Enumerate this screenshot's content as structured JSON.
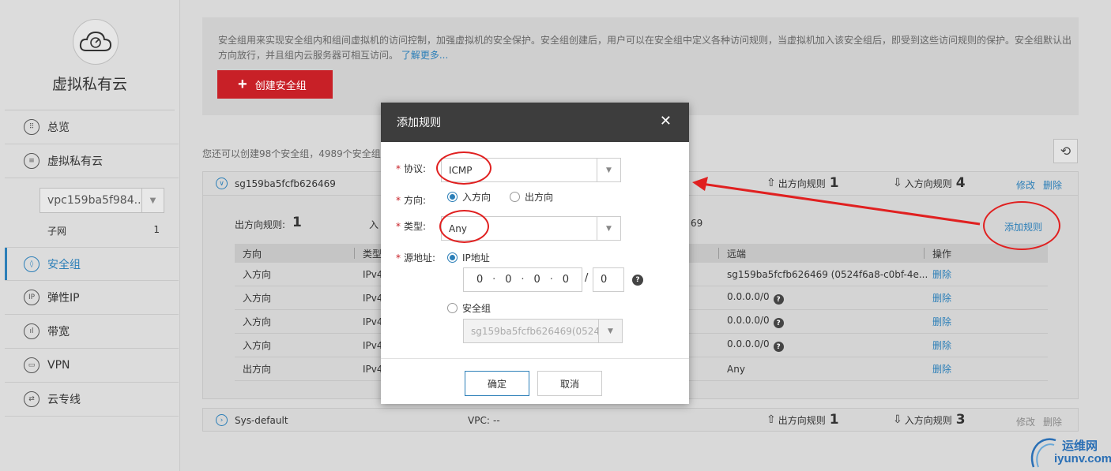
{
  "sidebar": {
    "brand_title": "虚拟私有云",
    "items": [
      {
        "label": "总览",
        "icon": "overview-icon"
      },
      {
        "label": "虚拟私有云",
        "icon": "vpc-icon"
      },
      {
        "label": "安全组",
        "icon": "shield-icon",
        "active": true
      },
      {
        "label": "弹性IP",
        "icon": "ip-icon"
      },
      {
        "label": "带宽",
        "icon": "bandwidth-icon"
      },
      {
        "label": "VPN",
        "icon": "vpn-icon"
      },
      {
        "label": "云专线",
        "icon": "direct-connect-icon"
      }
    ],
    "vpc_select": "vpc159ba5f984...",
    "subnet_label": "子网",
    "subnet_count": "1"
  },
  "main": {
    "intro_text": "安全组用来实现安全组内和组间虚拟机的访问控制，加强虚拟机的安全保护。安全组创建后，用户可以在安全组中定义各种访问规则，当虚拟机加入该安全组后，即受到这些访问规则的保护。安全组默认出方向放行，并且组内云服务器可相互访问。",
    "learn_more": "了解更多...",
    "create_button": "创建安全组",
    "quota_text": "您还可以创建98个安全组，4989个安全组规",
    "sg1": {
      "name": "sg159ba5fcfb626469",
      "outbound_label": "出方向规则",
      "outbound_count": "1",
      "inbound_label": "入方向规则",
      "inbound_count": "4",
      "edit": "修改",
      "delete": "删除",
      "add_rule": "添加规则",
      "summary_out_label": "出方向规则:",
      "summary_out_count": "1",
      "summary_in_prefix": "入",
      "summary_tail": "69",
      "table": {
        "headers": {
          "direction": "方向",
          "type": "类型",
          "remote": "远端",
          "action": "操作"
        },
        "rows": [
          {
            "direction": "入方向",
            "type": "IPv4",
            "remote": "sg159ba5fcfb626469 (0524f6a8-c0bf-4e...",
            "help": false,
            "action": "删除"
          },
          {
            "direction": "入方向",
            "type": "IPv4",
            "remote": "0.0.0.0/0",
            "help": true,
            "action": "删除"
          },
          {
            "direction": "入方向",
            "type": "IPv4",
            "remote": "0.0.0.0/0",
            "help": true,
            "action": "删除"
          },
          {
            "direction": "入方向",
            "type": "IPv4",
            "remote": "0.0.0.0/0",
            "help": true,
            "action": "删除"
          },
          {
            "direction": "出方向",
            "type": "IPv4",
            "remote": "Any",
            "help": false,
            "action": "删除"
          }
        ]
      }
    },
    "sg2": {
      "name": "Sys-default",
      "vpc_label": "VPC:",
      "vpc_value": "--",
      "outbound_label": "出方向规则",
      "outbound_count": "1",
      "inbound_label": "入方向规则",
      "inbound_count": "3",
      "edit": "修改",
      "delete": "删除"
    }
  },
  "modal": {
    "title": "添加规则",
    "protocol_label": "协议:",
    "protocol_value": "ICMP",
    "direction_label": "方向:",
    "direction_in": "入方向",
    "direction_out": "出方向",
    "type_label": "类型:",
    "type_value": "Any",
    "source_label": "源地址:",
    "source_ip_option": "IP地址",
    "ip_octets": [
      "0",
      "0",
      "0",
      "0"
    ],
    "mask_sep": "/",
    "mask_value": "0",
    "source_sg_option": "安全组",
    "sg_select_value": "sg159ba5fcfb626469(0524...",
    "confirm": "确定",
    "cancel": "取消"
  },
  "watermark": {
    "cn": "运维网",
    "en": "iyunv.com"
  },
  "colors": {
    "accent": "#2c7fb8",
    "brand_red": "#c82027",
    "annotation_red": "#e02020"
  }
}
